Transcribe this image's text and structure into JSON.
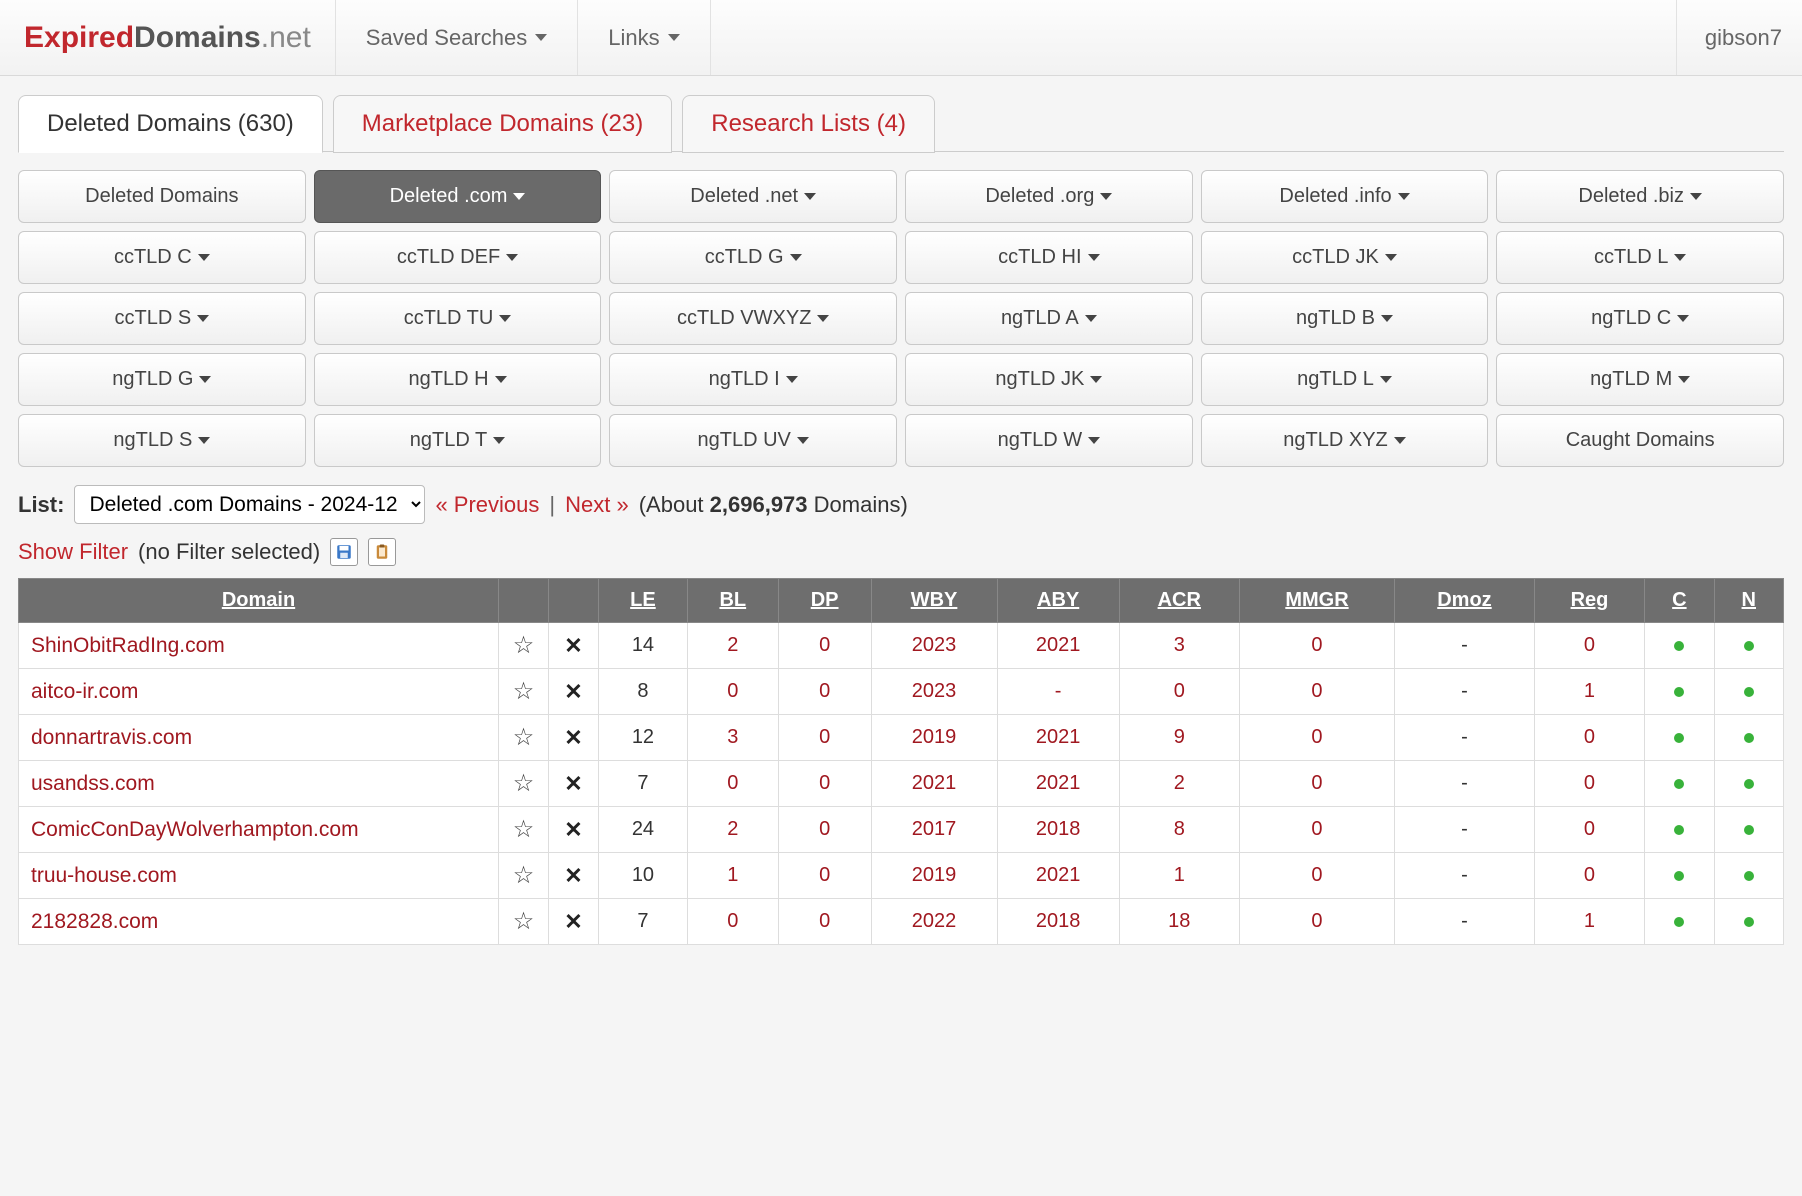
{
  "brand": {
    "p1": "Expired",
    "p2": "Domains",
    "p3": ".net"
  },
  "topnav": {
    "saved_searches": "Saved Searches",
    "links": "Links",
    "user": "gibson7"
  },
  "main_tabs": [
    {
      "label": "Deleted Domains (630)",
      "active": true
    },
    {
      "label": "Marketplace Domains (23)",
      "active": false
    },
    {
      "label": "Research Lists (4)",
      "active": false
    }
  ],
  "filter_rows": [
    [
      {
        "label": "Deleted Domains",
        "caret": false,
        "active": false
      },
      {
        "label": "Deleted .com",
        "caret": true,
        "active": true
      },
      {
        "label": "Deleted .net",
        "caret": true,
        "active": false
      },
      {
        "label": "Deleted .org",
        "caret": true,
        "active": false
      },
      {
        "label": "Deleted .info",
        "caret": true,
        "active": false
      },
      {
        "label": "Deleted .biz",
        "caret": true,
        "active": false
      }
    ],
    [
      {
        "label": "ccTLD C",
        "caret": true
      },
      {
        "label": "ccTLD DEF",
        "caret": true
      },
      {
        "label": "ccTLD G",
        "caret": true
      },
      {
        "label": "ccTLD HI",
        "caret": true
      },
      {
        "label": "ccTLD JK",
        "caret": true
      },
      {
        "label": "ccTLD L",
        "caret": true
      }
    ],
    [
      {
        "label": "ccTLD S",
        "caret": true
      },
      {
        "label": "ccTLD TU",
        "caret": true
      },
      {
        "label": "ccTLD VWXYZ",
        "caret": true
      },
      {
        "label": "ngTLD A",
        "caret": true
      },
      {
        "label": "ngTLD B",
        "caret": true
      },
      {
        "label": "ngTLD C",
        "caret": true
      }
    ],
    [
      {
        "label": "ngTLD G",
        "caret": true
      },
      {
        "label": "ngTLD H",
        "caret": true
      },
      {
        "label": "ngTLD I",
        "caret": true
      },
      {
        "label": "ngTLD JK",
        "caret": true
      },
      {
        "label": "ngTLD L",
        "caret": true
      },
      {
        "label": "ngTLD M",
        "caret": true
      }
    ],
    [
      {
        "label": "ngTLD S",
        "caret": true
      },
      {
        "label": "ngTLD T",
        "caret": true
      },
      {
        "label": "ngTLD UV",
        "caret": true
      },
      {
        "label": "ngTLD W",
        "caret": true
      },
      {
        "label": "ngTLD XYZ",
        "caret": true
      },
      {
        "label": "Caught Domains",
        "caret": false
      }
    ]
  ],
  "listline": {
    "label": "List:",
    "select_value": "Deleted .com Domains - 2024-12",
    "prev": "« Previous",
    "pipe": "|",
    "next": "Next »",
    "about_prefix": "(About ",
    "about_count": "2,696,973",
    "about_suffix": " Domains)"
  },
  "filterline": {
    "show_filter": "Show Filter",
    "no_filter": "(no Filter selected)"
  },
  "table": {
    "headers": [
      "Domain",
      "",
      "",
      "LE",
      "BL",
      "DP",
      "WBY",
      "ABY",
      "ACR",
      "MMGR",
      "Dmoz",
      "Reg",
      "C",
      "N"
    ],
    "rows": [
      {
        "domain": "ShinObitRadIng.com",
        "le": "14",
        "bl": "2",
        "dp": "0",
        "wby": "2023",
        "aby": "2021",
        "acr": "3",
        "mmgr": "0",
        "dmoz": "-",
        "reg": "0",
        "c": true,
        "n": true
      },
      {
        "domain": "aitco-ir.com",
        "le": "8",
        "bl": "0",
        "dp": "0",
        "wby": "2023",
        "aby": "-",
        "acr": "0",
        "mmgr": "0",
        "dmoz": "-",
        "reg": "1",
        "c": true,
        "n": true
      },
      {
        "domain": "donnartravis.com",
        "le": "12",
        "bl": "3",
        "dp": "0",
        "wby": "2019",
        "aby": "2021",
        "acr": "9",
        "mmgr": "0",
        "dmoz": "-",
        "reg": "0",
        "c": true,
        "n": true
      },
      {
        "domain": "usandss.com",
        "le": "7",
        "bl": "0",
        "dp": "0",
        "wby": "2021",
        "aby": "2021",
        "acr": "2",
        "mmgr": "0",
        "dmoz": "-",
        "reg": "0",
        "c": true,
        "n": true
      },
      {
        "domain": "ComicConDayWolverhampton.com",
        "le": "24",
        "bl": "2",
        "dp": "0",
        "wby": "2017",
        "aby": "2018",
        "acr": "8",
        "mmgr": "0",
        "dmoz": "-",
        "reg": "0",
        "c": true,
        "n": true
      },
      {
        "domain": "truu-house.com",
        "le": "10",
        "bl": "1",
        "dp": "0",
        "wby": "2019",
        "aby": "2021",
        "acr": "1",
        "mmgr": "0",
        "dmoz": "-",
        "reg": "0",
        "c": true,
        "n": true
      },
      {
        "domain": "2182828.com",
        "le": "7",
        "bl": "0",
        "dp": "0",
        "wby": "2022",
        "aby": "2018",
        "acr": "18",
        "mmgr": "0",
        "dmoz": "-",
        "reg": "1",
        "c": true,
        "n": true
      }
    ]
  }
}
